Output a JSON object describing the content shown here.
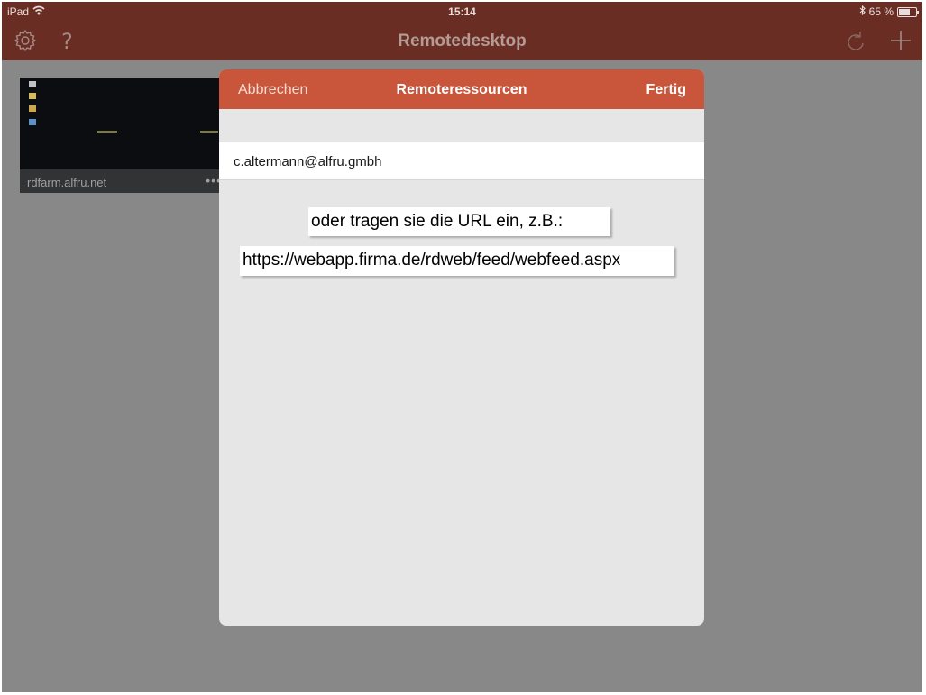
{
  "status_bar": {
    "device": "iPad",
    "time": "15:14",
    "battery_text": "65 %",
    "battery_level": 0.65
  },
  "nav": {
    "title": "Remotedesktop",
    "left_icons": [
      "gear-icon",
      "question-mark-icon"
    ],
    "right_icons": [
      "redo-arrow-icon",
      "plus-icon"
    ]
  },
  "desktops": [
    {
      "name": "rdfarm.alfru.net",
      "menu": "•••"
    }
  ],
  "modal": {
    "cancel_label": "Abbrechen",
    "title": "Remoteressourcen",
    "done_label": "Fertig",
    "email_value": "c.altermann@alfru.gmbh",
    "hint_text": "oder tragen sie die URL ein, z.B.:",
    "example_url": "https://webapp.firma.de/rdweb/feed/webfeed.aspx"
  },
  "colors": {
    "nav_bar": "#6a2d24",
    "modal_header": "#c9563a",
    "backdrop": "#888889"
  }
}
